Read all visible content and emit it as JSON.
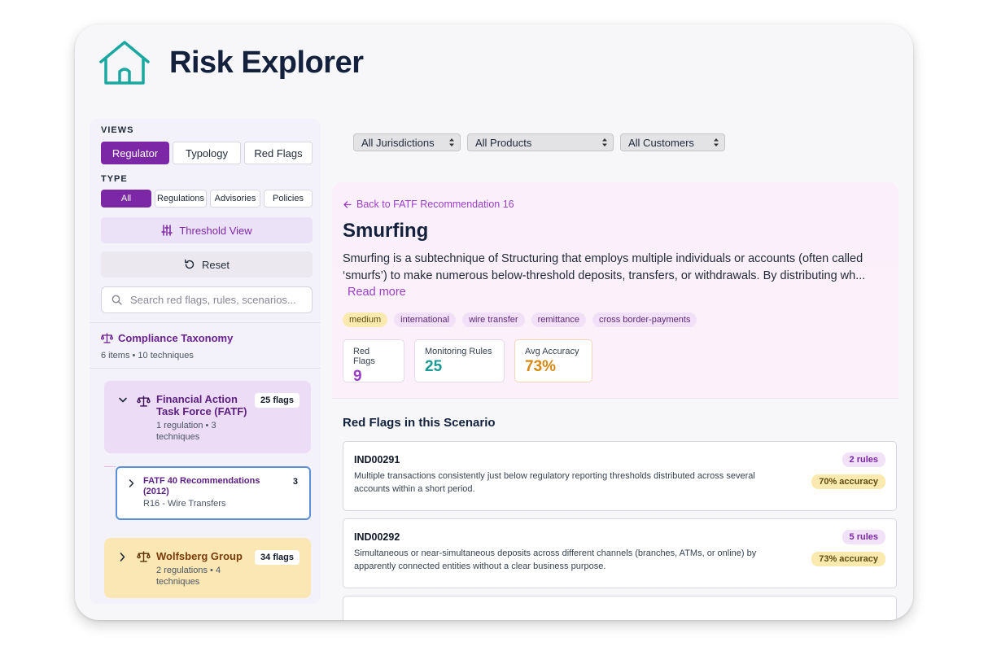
{
  "app": {
    "title": "Risk Explorer",
    "logo_icon": "home-icon",
    "accent": "#7b27a6",
    "teal": "#1aa7a0"
  },
  "sidebar": {
    "views_label": "VIEWS",
    "views": [
      "Regulator",
      "Typology",
      "Red Flags"
    ],
    "type_label": "TYPE",
    "types": [
      "All",
      "Regulations",
      "Advisories",
      "Policies"
    ],
    "threshold_label": "Threshold View",
    "reset_label": "Reset",
    "search_placeholder": "Search red flags, rules, scenarios...",
    "taxonomy": {
      "title": "Compliance Taxonomy",
      "subtitle": "6 items • 10 techniques"
    },
    "groups": [
      {
        "title_line1": "Financial Action",
        "title_line2": "Task Force (FATF)",
        "sub_line1": "1 regulation • 3",
        "sub_line2": "techniques",
        "badge": "25 flags"
      },
      {
        "title_line1": "Wolfsberg Group",
        "sub_line1": "2 regulations • 4",
        "sub_line2": "techniques",
        "badge": "34 flags"
      }
    ],
    "sub_item": {
      "title_line1": "FATF 40 Recommendations",
      "title_line2": "(2012)",
      "subtitle": "R16 - Wire Transfers",
      "count": "3"
    }
  },
  "filters": {
    "jurisdiction": "All Jurisdictions",
    "products": "All Products",
    "customers": "All Customers"
  },
  "scenario": {
    "back_label": "Back to FATF Recommendation 16",
    "title": "Smurfing",
    "desc_line1": "Smurfing is a subtechnique of Structuring that employs multiple individuals or accounts (often called",
    "desc_line2": "‘smurfs’) to make numerous below-threshold deposits, transfers, or withdrawals. By distributing wh...",
    "read_more": "Read more",
    "tags": [
      "medium",
      "international",
      "wire transfer",
      "remittance",
      "cross border-payments"
    ],
    "stats": [
      {
        "label": "Red Flags",
        "value": "9",
        "color": "#9b3fc7"
      },
      {
        "label": "Monitoring Rules",
        "value": "25",
        "color": "#1a9a93"
      },
      {
        "label": "Avg Accuracy",
        "value": "73%",
        "color": "#d68910"
      }
    ]
  },
  "red_flags": {
    "heading": "Red Flags in this Scenario",
    "items": [
      {
        "id": "IND00291",
        "desc_line1": "Multiple transactions consistently just below regulatory reporting thresholds distributed across several",
        "desc_line2": "accounts within a short period.",
        "rules": "2 rules",
        "accuracy": "70% accuracy"
      },
      {
        "id": "IND00292",
        "desc_line1": "Simultaneous or near-simultaneous deposits across different channels (branches, ATMs, or online) by",
        "desc_line2": "apparently connected entities without a clear business purpose.",
        "rules": "5 rules",
        "accuracy": "73% accuracy"
      }
    ]
  }
}
